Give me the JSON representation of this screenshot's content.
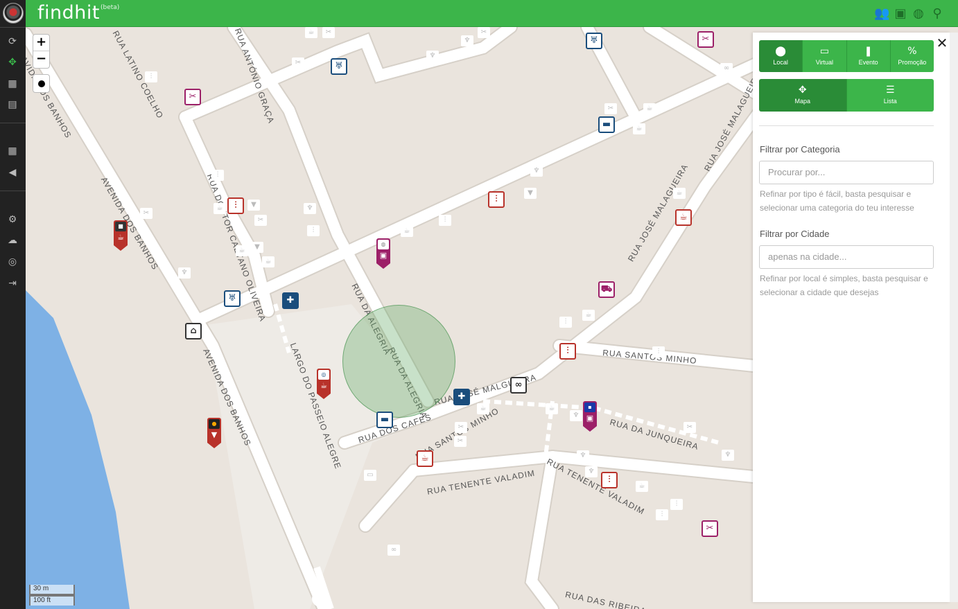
{
  "app": {
    "logo": "findhit",
    "badge": "(beta)"
  },
  "sidebar": {
    "items": [
      {
        "icon": "refresh-icon",
        "glyph": "⟳"
      },
      {
        "icon": "crosshair-icon",
        "glyph": "✥"
      },
      {
        "icon": "calendar-icon",
        "glyph": "▦"
      },
      {
        "icon": "contacts-icon",
        "glyph": "▤"
      },
      {
        "icon": "dashboard-icon",
        "glyph": "▦"
      },
      {
        "icon": "megaphone-icon",
        "glyph": "◀"
      },
      {
        "icon": "gear-icon",
        "glyph": "⚙"
      },
      {
        "icon": "cloud-icon",
        "glyph": "☁"
      },
      {
        "icon": "lifebuoy-icon",
        "glyph": "◎"
      },
      {
        "icon": "signout-icon",
        "glyph": "⇥"
      }
    ]
  },
  "topbar": {
    "icons": [
      {
        "name": "users-icon",
        "glyph": "👥"
      },
      {
        "name": "chat-icon",
        "glyph": "▣"
      },
      {
        "name": "globe-icon",
        "glyph": "◍"
      },
      {
        "name": "search-icon",
        "glyph": "⚲"
      }
    ],
    "accent": "#3cb54a"
  },
  "map": {
    "zoom_in": "+",
    "zoom_out": "−",
    "scale_metric": "30 m",
    "scale_imperial": "100 ft",
    "streets": [
      "RUA LATINO COELHO",
      "RUA ANTÓNIO GRAÇA",
      "AVENIDA DOS BANHOS",
      "AVENIDA DOS BANHOS",
      "RUA DOUTOR CAETANO OLIVEIRA",
      "RUA DA ALEGRIA",
      "RUA DA ALEGRIA",
      "LARGO DO PASSEIO ALEGRE",
      "RUA JOSÉ MALAGUEIRA",
      "RUA JOSÉ MALAGUEIRA",
      "RUA SANTOS MINHO",
      "RUA JOSÉ MALGUEIRA",
      "RUA DA JUNQUEIRA",
      "RUA TENENTE VALADIM",
      "RUA TENENTE VALADIM",
      "RUA DOS CAFES",
      "RUA SANTOS MINHO",
      "RUA DAS RIBEIRAS",
      "AVIDA DOS BANHOS"
    ]
  },
  "panel": {
    "tabs": [
      {
        "label": "Local",
        "icon": "map-marker-icon",
        "glyph": "⬤"
      },
      {
        "label": "Virtual",
        "icon": "browser-icon",
        "glyph": "▭"
      },
      {
        "label": "Evento",
        "icon": "bookmark-icon",
        "glyph": "❚"
      },
      {
        "label": "Promoção",
        "icon": "percent-icon",
        "glyph": "%"
      }
    ],
    "views": [
      {
        "label": "Mapa",
        "icon": "crosshair-icon",
        "glyph": "✥"
      },
      {
        "label": "Lista",
        "icon": "list-icon",
        "glyph": "☰"
      }
    ],
    "category_label": "Filtrar por Categoria",
    "category_placeholder": "Procurar por...",
    "category_help": "Refinar por tipo é fácil, basta pesquisar e selecionar uma categoria do teu interesse",
    "city_label": "Filtrar por Cidade",
    "city_placeholder": "apenas na cidade...",
    "city_help": "Refinar por local é simples, basta pesquisar e selecionar a cidade que desejas",
    "close": "✕"
  }
}
